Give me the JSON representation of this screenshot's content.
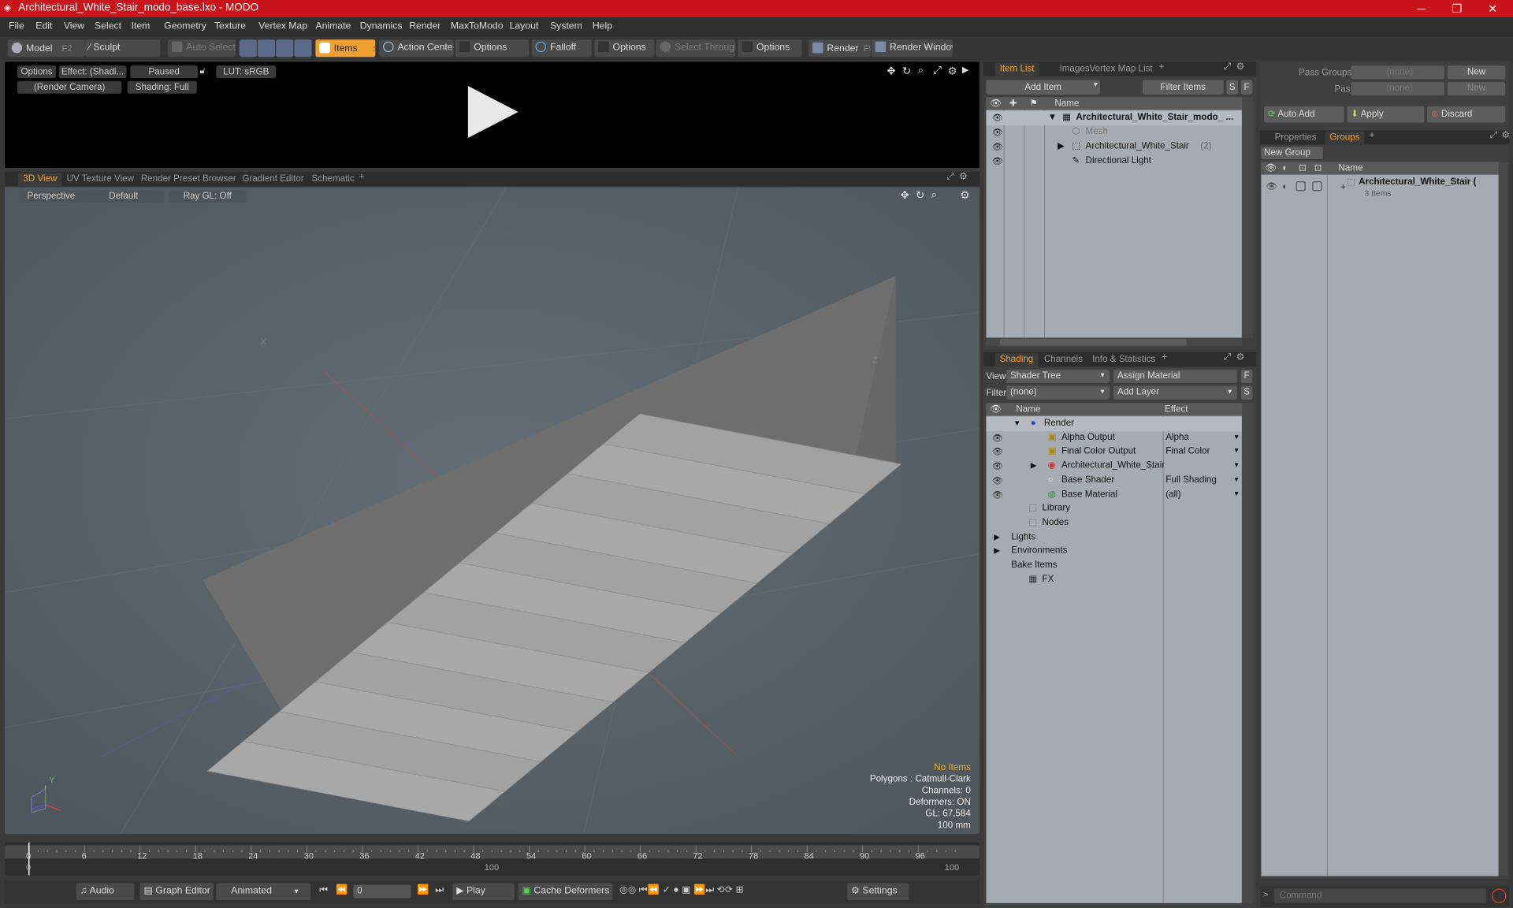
{
  "window": {
    "title": "Architectural_White_Stair_modo_base.lxo - MODO",
    "controls": [
      "─",
      "❐",
      "✕"
    ]
  },
  "menu": [
    "File",
    "Edit",
    "View",
    "Select",
    "Item",
    "Geometry",
    "Texture",
    "Vertex Map",
    "Animate",
    "Dynamics",
    "Render",
    "MaxToModo",
    "Layout",
    "System",
    "Help"
  ],
  "toolbar": {
    "model": "Model",
    "model_key": "F2",
    "sculpt": "Sculpt",
    "auto_select": "Auto Select",
    "items": "Items",
    "items_key": "S",
    "action_center": "Action Center",
    "options1": "Options",
    "falloff": "Falloff",
    "options2": "Options",
    "select_through": "Select Through",
    "options3": "Options",
    "render": "Render",
    "render_key": "F9",
    "render_window": "Render Window"
  },
  "preview": {
    "options": "Options",
    "effect": "Effect: (Shadi...",
    "paused": "Paused",
    "lut": "LUT: sRGB",
    "camera": "(Render Camera)",
    "shading": "Shading: Full"
  },
  "viewtabs": [
    "3D View",
    "UV Texture View",
    "Render Preset Browser",
    "Gradient Editor",
    "Schematic"
  ],
  "viewport": {
    "perspective": "Perspective",
    "default": "Default",
    "raygl": "Ray GL: Off",
    "axis_labels": {
      "x": "X",
      "z": "Z",
      "y": "Y"
    },
    "stats": {
      "no_items": "No Items",
      "polygons": "Polygons : Catmull-Clark",
      "channels": "Channels: 0",
      "deformers": "Deformers: ON",
      "gl": "GL: 67,584",
      "unit": "100 mm"
    }
  },
  "timeline": {
    "ticks": [
      "0",
      "6",
      "12",
      "18",
      "24",
      "30",
      "36",
      "42",
      "48",
      "54",
      "60",
      "66",
      "72",
      "78",
      "84",
      "90",
      "96"
    ],
    "lower_start": "0",
    "lower_mid": "100",
    "lower_end": "100"
  },
  "bottombar": {
    "audio": "Audio",
    "graph_editor": "Graph Editor",
    "animated": "Animated",
    "frame": "0",
    "play": "Play",
    "cache": "Cache Deformers",
    "settings": "Settings"
  },
  "itemlist": {
    "tabs": [
      "Item List",
      "Images",
      "Vertex Map List"
    ],
    "add_item": "Add Item",
    "filter_items": "Filter Items",
    "s": "S",
    "f": "F",
    "col_name": "Name",
    "rows": [
      {
        "label": "Architectural_White_Stair_modo_ ..."
      },
      {
        "label": "Mesh"
      },
      {
        "label": "Architectural_White_Stair",
        "suffix": "(2)"
      },
      {
        "label": "Directional Light"
      }
    ]
  },
  "shading": {
    "tabs": [
      "Shading",
      "Channels",
      "Info & Statistics"
    ],
    "view_label": "View",
    "view_value": "Shader Tree",
    "assign_material": "Assign Material",
    "filter_label": "Filter",
    "filter_value": "(none)",
    "add_layer": "Add Layer",
    "f": "F",
    "s": "S",
    "col_name": "Name",
    "col_effect": "Effect",
    "rows": [
      {
        "label": "Render",
        "effect": ""
      },
      {
        "label": "Alpha Output",
        "effect": "Alpha"
      },
      {
        "label": "Final Color Output",
        "effect": "Final Color"
      },
      {
        "label": "Architectural_White_Stair",
        "extra": "(...",
        "effect": ""
      },
      {
        "label": "Base Shader",
        "effect": "Full Shading"
      },
      {
        "label": "Base Material",
        "effect": "(all)"
      },
      {
        "label": "Library",
        "effect": ""
      },
      {
        "label": "Nodes",
        "effect": ""
      },
      {
        "label": "Lights",
        "effect": ""
      },
      {
        "label": "Environments",
        "effect": ""
      },
      {
        "label": "Bake Items",
        "effect": ""
      },
      {
        "label": "FX",
        "effect": ""
      }
    ]
  },
  "groups": {
    "pass_groups": "Pass Groups",
    "none1": "(none)",
    "new1": "New",
    "passes": "Passes",
    "none2": "(none)",
    "new2": "New",
    "auto_add": "Auto Add",
    "apply": "Apply",
    "discard": "Discard",
    "tabs": [
      "Properties",
      "Groups"
    ],
    "new_group": "New Group",
    "col_name": "Name",
    "item_name": "Architectural_White_Stair (",
    "item_count": "3 Items"
  },
  "command": {
    "placeholder": "Command"
  }
}
